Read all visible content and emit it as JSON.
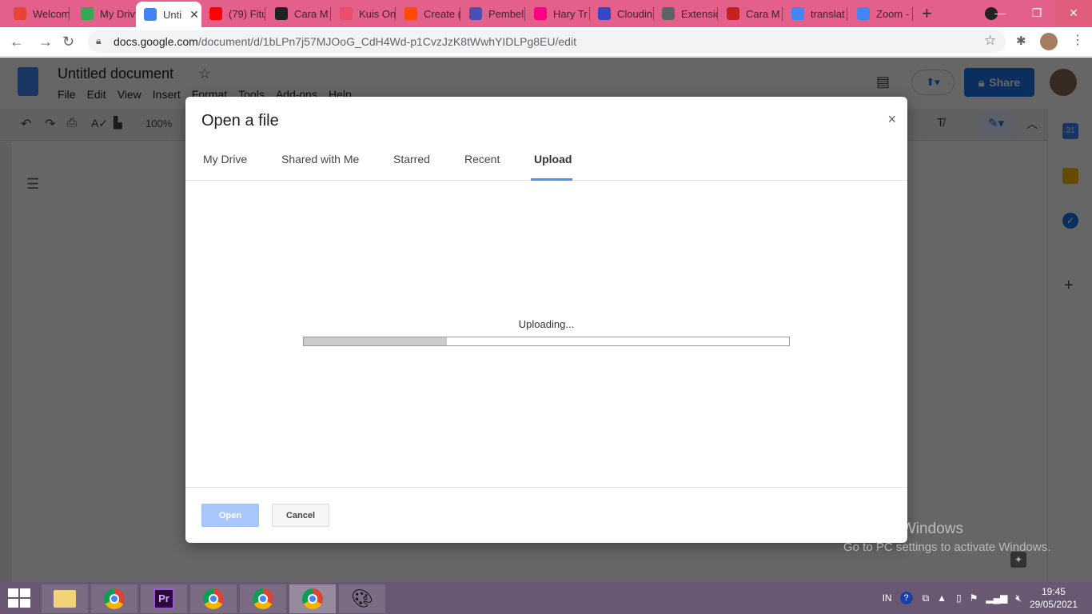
{
  "browser": {
    "tabs": [
      {
        "label": "Welcom",
        "icon": "gmail-icon",
        "color": "#ea4335"
      },
      {
        "label": "My Driv",
        "icon": "drive-icon",
        "color": "#34a853"
      },
      {
        "label": "Unti",
        "icon": "docs-icon",
        "color": "#4285f4",
        "active": true
      },
      {
        "label": "(79) Fitu",
        "icon": "youtube-icon",
        "color": "#ff0000"
      },
      {
        "label": "Cara M",
        "icon": "app-icon",
        "color": "#202124"
      },
      {
        "label": "Kuis On",
        "icon": "quiz-icon",
        "color": "#e94f6b"
      },
      {
        "label": "Create (",
        "icon": "zapier-icon",
        "color": "#ff4a00"
      },
      {
        "label": "Pembel",
        "icon": "form-icon",
        "color": "#4b4fb5"
      },
      {
        "label": "Hary Tr",
        "icon": "flickr-icon",
        "color": "#ff0084"
      },
      {
        "label": "Cloudin",
        "icon": "cloudinary-icon",
        "color": "#3448c5"
      },
      {
        "label": "Extensic",
        "icon": "puzzle-icon",
        "color": "#5f6368"
      },
      {
        "label": "Cara M",
        "icon": "x-icon",
        "color": "#c5221f"
      },
      {
        "label": "translat",
        "icon": "google-icon",
        "color": "#4285f4"
      },
      {
        "label": "Zoom -",
        "icon": "google-icon",
        "color": "#4285f4"
      }
    ],
    "close_tab": "✕",
    "new_tab": "+",
    "url_domain": "docs.google.com",
    "url_path": "/document/d/1bLPn7j57MJOoG_CdH4Wd-p1CvzJzK8tWwhYIDLPg8EU/edit"
  },
  "docs": {
    "title": "Untitled document",
    "menu": [
      "File",
      "Edit",
      "View",
      "Insert",
      "Format",
      "Tools",
      "Add-ons",
      "Help"
    ],
    "zoom": "100%",
    "share_label": "Share"
  },
  "dialog": {
    "title": "Open a file",
    "close": "×",
    "tabs": [
      "My Drive",
      "Shared with Me",
      "Starred",
      "Recent",
      "Upload"
    ],
    "active_tab": "Upload",
    "status": "Uploading...",
    "progress": 0.295,
    "open_label": "Open",
    "cancel_label": "Cancel"
  },
  "watermark": {
    "line1": "Activate Windows",
    "line2": "Go to PC settings to activate Windows."
  },
  "taskbar": {
    "lang": "IN",
    "time": "19:45",
    "date": "29/05/2021"
  }
}
